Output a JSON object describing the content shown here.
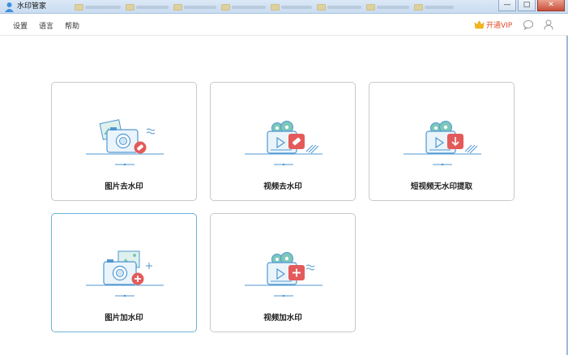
{
  "window": {
    "title": "水印管家",
    "controls": {
      "minimize": "—",
      "maximize": "□",
      "close": "✕"
    }
  },
  "menu": {
    "items": [
      {
        "label": "设置"
      },
      {
        "label": "语言"
      },
      {
        "label": "帮助"
      }
    ],
    "vip_label": "开通VIP"
  },
  "cards": [
    {
      "label": "图片去水印"
    },
    {
      "label": "视频去水印"
    },
    {
      "label": "短视频无水印提取"
    },
    {
      "label": "图片加水印"
    },
    {
      "label": "视频加水印"
    }
  ],
  "colors": {
    "accent_red": "#e45a5a",
    "icon_blue": "#4f97d1",
    "icon_teal": "#7cc7b9",
    "vip_text": "#e04a2a"
  }
}
